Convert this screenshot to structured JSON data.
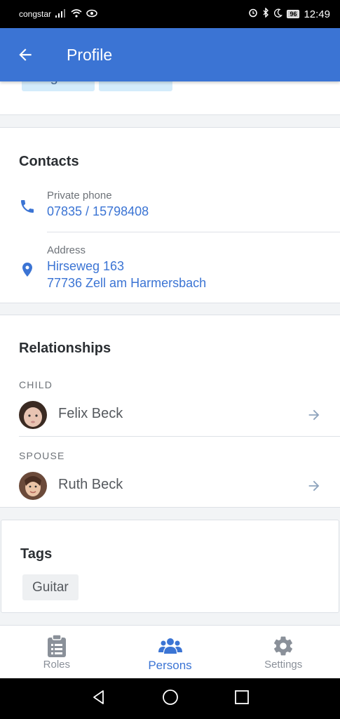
{
  "status_bar": {
    "carrier": "congstar",
    "battery": "96",
    "time": "12:49"
  },
  "appbar": {
    "title": "Profile"
  },
  "top_chips": [
    "Mitglied",
    "Zentrale"
  ],
  "contacts": {
    "title": "Contacts",
    "phone_label": "Private phone",
    "phone_value": "07835 / 15798408",
    "address_label": "Address",
    "address_line1": "Hirseweg 163",
    "address_line2": "77736 Zell am Harmersbach"
  },
  "relationships": {
    "title": "Relationships",
    "groups": [
      {
        "label": "CHILD",
        "name": "Felix Beck"
      },
      {
        "label": "SPOUSE",
        "name": "Ruth Beck"
      }
    ]
  },
  "tags": {
    "title": "Tags",
    "items": [
      "Guitar"
    ]
  },
  "bottom_nav": {
    "items": [
      {
        "label": "Roles",
        "icon": "clipboard-icon",
        "active": false
      },
      {
        "label": "Persons",
        "icon": "people-icon",
        "active": true
      },
      {
        "label": "Settings",
        "icon": "gear-icon",
        "active": false
      }
    ]
  },
  "colors": {
    "primary": "#3b74d4",
    "chip_blue": "#d4ecfb",
    "muted": "#8a9099"
  }
}
